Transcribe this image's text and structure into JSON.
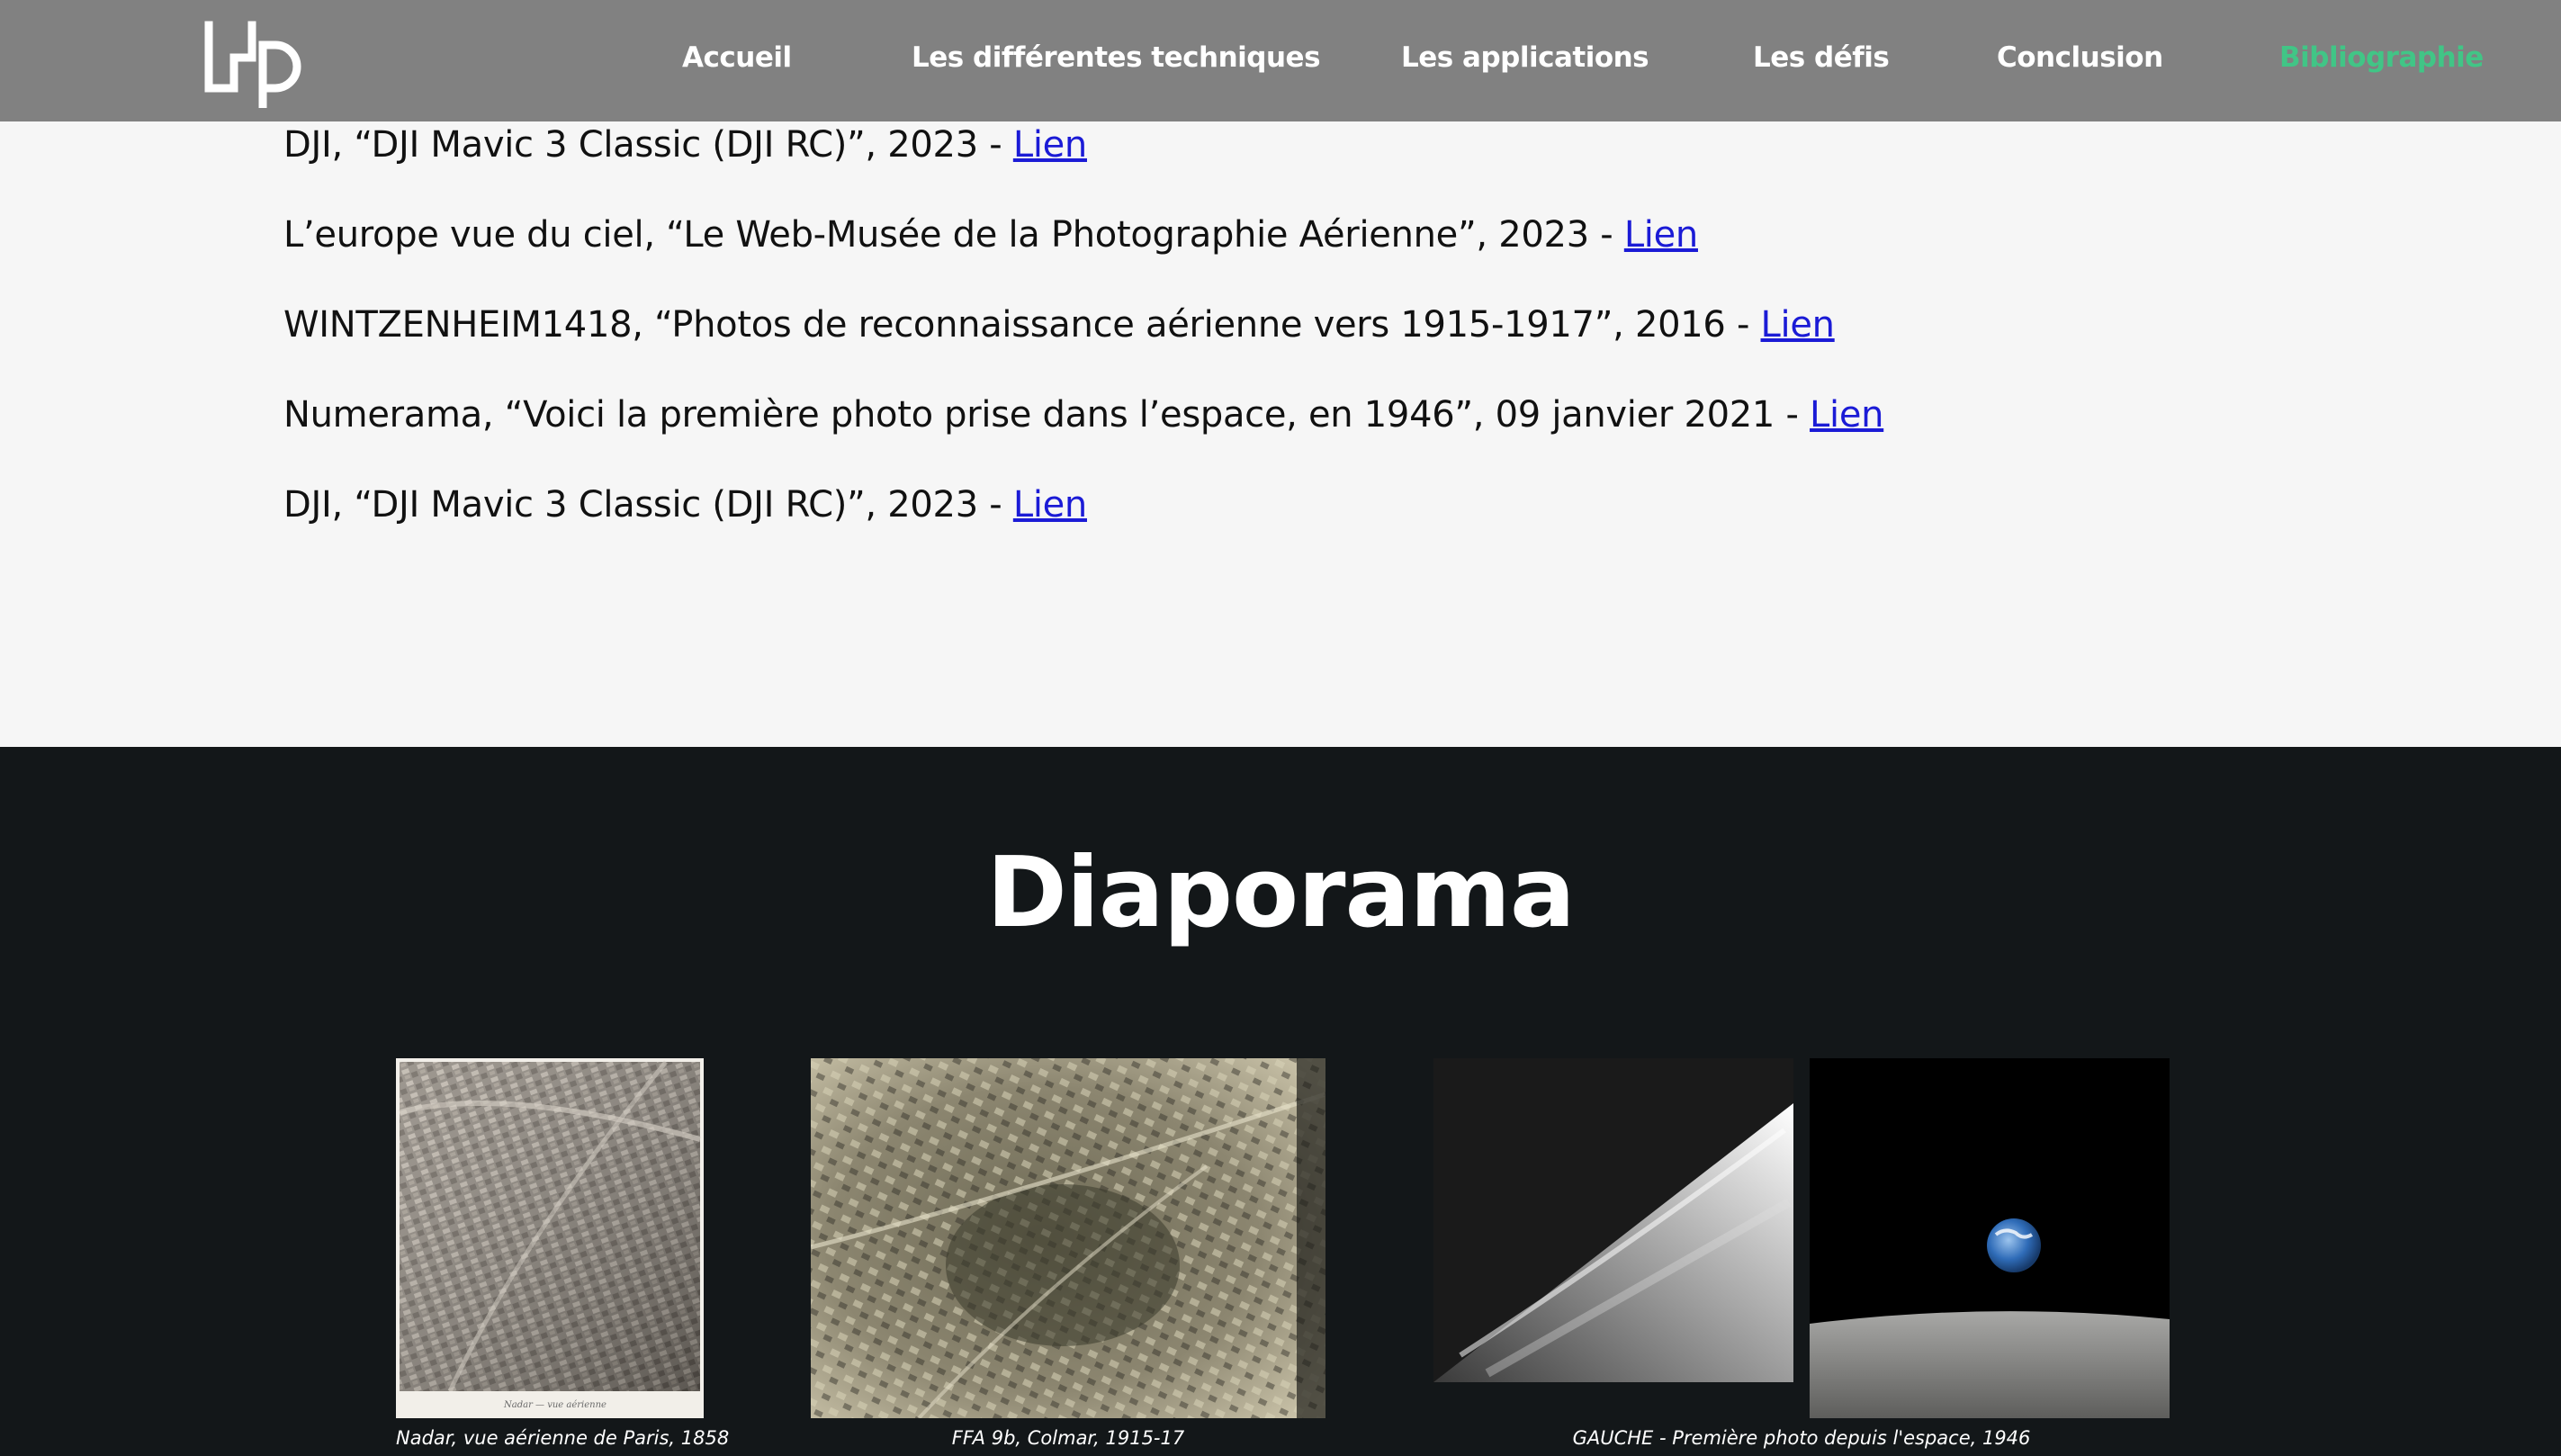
{
  "nav": {
    "logo_text": "LHP",
    "items": [
      {
        "label": "Accueil"
      },
      {
        "label": "Les différentes techniques"
      },
      {
        "label": "Les applications"
      },
      {
        "label": "Les défis"
      },
      {
        "label": "Conclusion"
      },
      {
        "label": "Bibliographie",
        "active": true
      }
    ],
    "active_color": "#41c586"
  },
  "bibliography": [
    {
      "text": "DJI, “DJI Mavic 3 Classic (DJI RC)”, 2023 - ",
      "link": "Lien"
    },
    {
      "text": "L’europe vue du ciel, “Le Web-Musée de la Photographie Aérienne”, 2023 - ",
      "link": "Lien"
    },
    {
      "text": "WINTZENHEIM1418, “Photos de reconnaissance aérienne vers 1915-1917”, 2016 - ",
      "link": "Lien"
    },
    {
      "text": "Numerama, “Voici la première photo prise dans l’espace, en 1946”, 09 janvier 2021 - ",
      "link": "Lien"
    },
    {
      "text": "DJI, “DJI Mavic 3 Classic (DJI RC)”, 2023 - ",
      "link": "Lien"
    }
  ],
  "slideshow": {
    "title": "Diaporama",
    "captions": [
      "Nadar, vue aérienne de Paris, 1858",
      "FFA 9b, Colmar, 1915-17",
      "GAUCHE - Première photo depuis l'espace, 1946"
    ]
  },
  "colors": {
    "link": "#1b1bd6",
    "dark_bg": "#131719",
    "light_bg": "#f6f6f6"
  }
}
